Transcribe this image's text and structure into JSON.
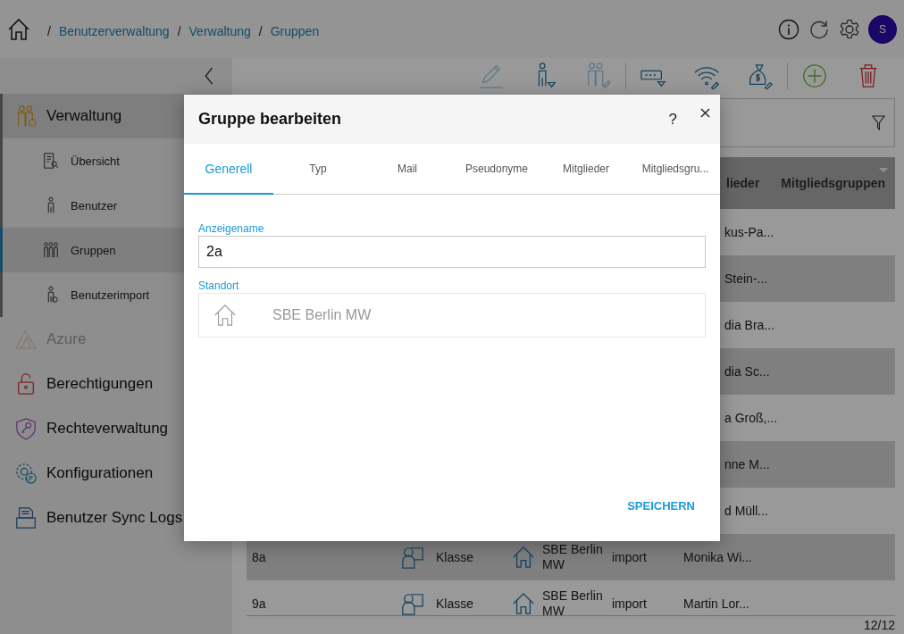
{
  "breadcrumb": [
    {
      "separator": "/",
      "label": "Benutzerverwaltung"
    },
    {
      "separator": "/",
      "label": "Verwaltung"
    },
    {
      "separator": "/",
      "label": "Gruppen"
    }
  ],
  "avatar": {
    "initial": "S"
  },
  "toolbar": [
    {
      "disabled": true
    },
    {
      "disabled": false
    },
    {
      "disabled": true
    },
    {
      "disabled": false
    },
    {
      "disabled": false
    },
    {
      "disabled": false
    },
    {
      "disabled": false
    },
    {
      "disabled": false
    }
  ],
  "sidebar": {
    "items": [
      {
        "label": "Verwaltung",
        "selected": true,
        "disabled": false,
        "expanded": true,
        "children": [
          {
            "label": "Übersicht",
            "selected": false
          },
          {
            "label": "Benutzer",
            "selected": false
          },
          {
            "label": "Gruppen",
            "selected": true
          },
          {
            "label": "Benutzerimport",
            "selected": false
          }
        ]
      },
      {
        "label": "Azure",
        "selected": false,
        "disabled": true,
        "expanded": false
      },
      {
        "label": "Berechtigungen",
        "selected": false,
        "disabled": false,
        "expanded": false
      },
      {
        "label": "Rechteverwaltung",
        "selected": false,
        "disabled": false,
        "expanded": false
      },
      {
        "label": "Konfigurationen",
        "selected": false,
        "disabled": false,
        "expanded": false
      },
      {
        "label": "Benutzer Sync Logs",
        "selected": false,
        "disabled": false,
        "expanded": false
      }
    ]
  },
  "table": {
    "columns": [
      {
        "label": "lieder"
      },
      {
        "label": "Mitgliedsgruppen"
      }
    ],
    "rows": [
      {
        "kind": "partial",
        "members": "kus-Pa..."
      },
      {
        "kind": "partial",
        "members": "Stein-..."
      },
      {
        "kind": "partial",
        "members": "dia Bra..."
      },
      {
        "kind": "partial",
        "members": "dia Sc..."
      },
      {
        "kind": "partial",
        "members": "a Groß,..."
      },
      {
        "kind": "partial",
        "members": "nne M..."
      },
      {
        "kind": "partial",
        "members": "d Müll..."
      },
      {
        "kind": "full",
        "name": "8a",
        "type": "Klasse",
        "location": "SBE Berlin MW",
        "source": "import",
        "members": "Monika Wi..."
      },
      {
        "kind": "full",
        "name": "9a",
        "type": "Klasse",
        "location": "SBE Berlin MW",
        "source": "import",
        "members": "Martin Lor..."
      }
    ],
    "count": "12/12"
  },
  "dialog": {
    "title": "Gruppe bearbeiten",
    "help": "?",
    "tabs": [
      {
        "label": "Generell",
        "selected": true
      },
      {
        "label": "Typ",
        "selected": false
      },
      {
        "label": "Mail",
        "selected": false
      },
      {
        "label": "Pseudonyme",
        "selected": false
      },
      {
        "label": "Mitglieder",
        "selected": false
      },
      {
        "label": "Mitgliedsgru...",
        "selected": false
      }
    ],
    "fields": [
      {
        "kind": "text",
        "label": "Anzeigename",
        "value": "2a"
      },
      {
        "kind": "location",
        "label": "Standort",
        "value": "SBE Berlin MW"
      }
    ],
    "save_button": "SPEICHERN"
  }
}
